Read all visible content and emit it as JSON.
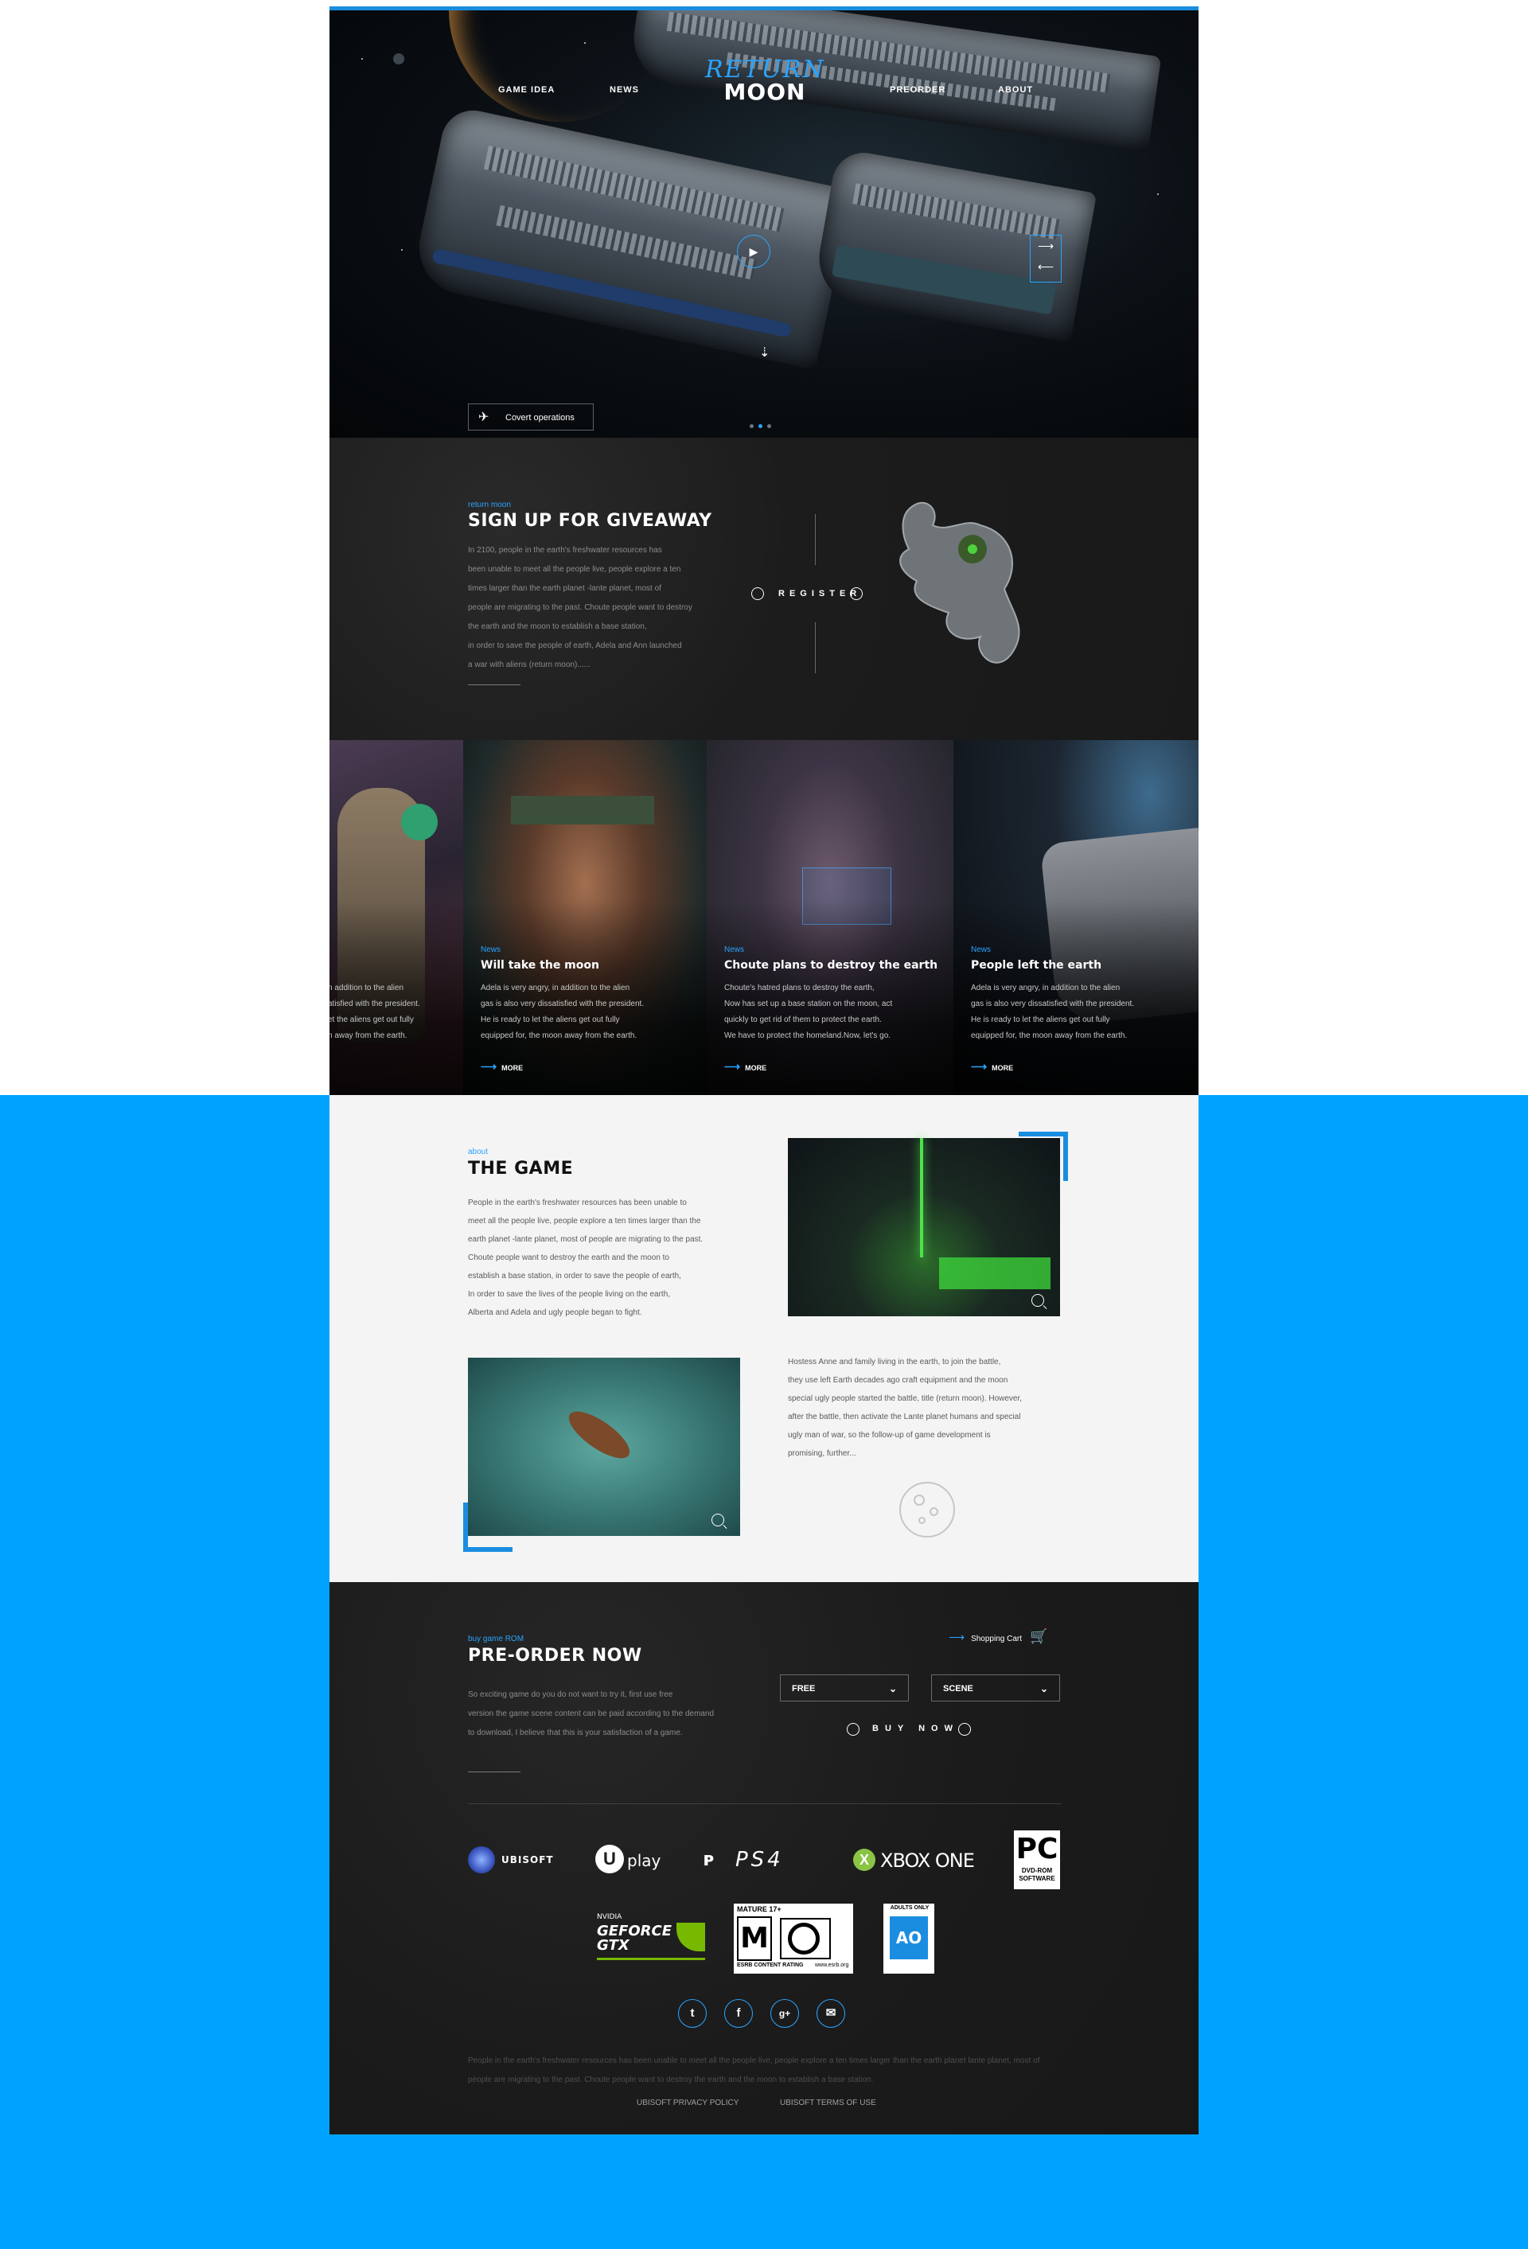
{
  "nav": {
    "links": [
      "GAME IDEA",
      "NEWS",
      "PREORDER",
      "ABOUT"
    ],
    "logo_line1": "RETURN",
    "logo_line2": "MOON"
  },
  "hero": {
    "slide_label": "Covert operations",
    "active_slide": 2,
    "slide_count": 3
  },
  "giveaway": {
    "kicker": "return moon",
    "title": "SIGN UP FOR GIVEAWAY",
    "lines": [
      "In 2100, people in the earth's freshwater resources has",
      "been unable to meet all the people live, people explore a ten",
      "times larger than the earth planet -lante planet, most of",
      "people are migrating to the past. Choute people want to destroy",
      "the earth and the moon to establish a base station,",
      "in order to save the people of earth, Adela and Ann launched",
      "a war with aliens (return moon)......"
    ],
    "register": "REGISTER"
  },
  "news": [
    {
      "kicker": "",
      "title": "",
      "lines": [
        "n addition to the alien",
        "atisfied with the president.",
        "et the aliens get out fully",
        "n away from the earth."
      ],
      "more": ""
    },
    {
      "kicker": "News",
      "title": "Will take the moon",
      "lines": [
        "Adela is very angry, in addition to the alien",
        "gas is also very dissatisfied with the president.",
        "He is ready to let the aliens get out fully",
        "equipped for, the moon away from the earth."
      ],
      "more": "MORE"
    },
    {
      "kicker": "News",
      "title": "Choute plans to destroy the earth",
      "lines": [
        "Choute's hatred plans to destroy the earth,",
        "Now has set up a base station on the moon, act",
        "quickly to get rid of them to protect the earth.",
        "We have to protect the homeland.Now,  let's go."
      ],
      "more": "MORE"
    },
    {
      "kicker": "News",
      "title": "People left the earth",
      "lines": [
        "Adela is very angry, in addition to the alien",
        "gas is also very dissatisfied with the president.",
        "He is ready to let the aliens get out fully",
        "equipped for, the moon away from the earth."
      ],
      "more": "MORE"
    }
  ],
  "about": {
    "kicker": "about",
    "title": "THE GAME",
    "lines": [
      "People in the earth's freshwater resources has been unable to",
      "meet all the people live, people explore a ten times larger than the",
      "earth planet -lante planet, most of people are migrating to the past.",
      "Choute people want to destroy the earth and the moon to",
      "establish a base station, in order to save the people of earth,",
      "In order to save the lives of the people living on the earth,",
      "Alberta and Adela and ugly people began to fight."
    ],
    "lines2": [
      "Hostess Anne and family living in the earth, to join the battle,",
      "they use left Earth decades ago craft equipment and the moon",
      "special ugly people started the battle, title (return moon). However,",
      "after the battle, then activate the Lante planet humans and special",
      "ugly man of war, so the follow-up of game development is",
      "promising, further..."
    ]
  },
  "preorder": {
    "kicker": "buy game ROM",
    "title": "PRE-ORDER NOW",
    "lines": [
      "So exciting game do you do not want to try it, first use free",
      "version the game scene content can be paid according to the demand",
      "to download, I believe that this is your satisfaction of a game."
    ],
    "cart": "Shopping Cart",
    "select1": "FREE",
    "select2": "SCENE",
    "buy": "BUY NOW"
  },
  "brands": {
    "ubisoft": "UBISOFT",
    "uplay": "play",
    "ps4": "PS4",
    "xbox": "XBOX ONE",
    "pc_big": "PC",
    "pc_small1": "DVD-ROM",
    "pc_small2": "SOFTWARE",
    "nvidia_small": "NVIDIA",
    "nvidia_big1": "GEFORCE",
    "nvidia_big2": "GTX",
    "mature": "MATURE 17+",
    "mature_m": "M",
    "esrb": "ESRB CONTENT RATING",
    "esrb_url": "www.esrb.org",
    "adults": "ADULTS ONLY",
    "ao": "AO"
  },
  "footer": {
    "text": "People in the earth's freshwater resources has been unable to meet all the people live, people explore a ten times larger than the earth planet lante planet, most of people are migrating to the past. Choute people want to destroy the earth and the moon to establish a base station.",
    "privacy": "UBISOFT PRIVACY POLICY",
    "terms": "UBISOFT TERMS OF USE"
  },
  "colors": {
    "accent": "#2aa4ff",
    "band": "#00a2ff",
    "dark": "#1c1c1c",
    "light": "#f4f4f4"
  }
}
